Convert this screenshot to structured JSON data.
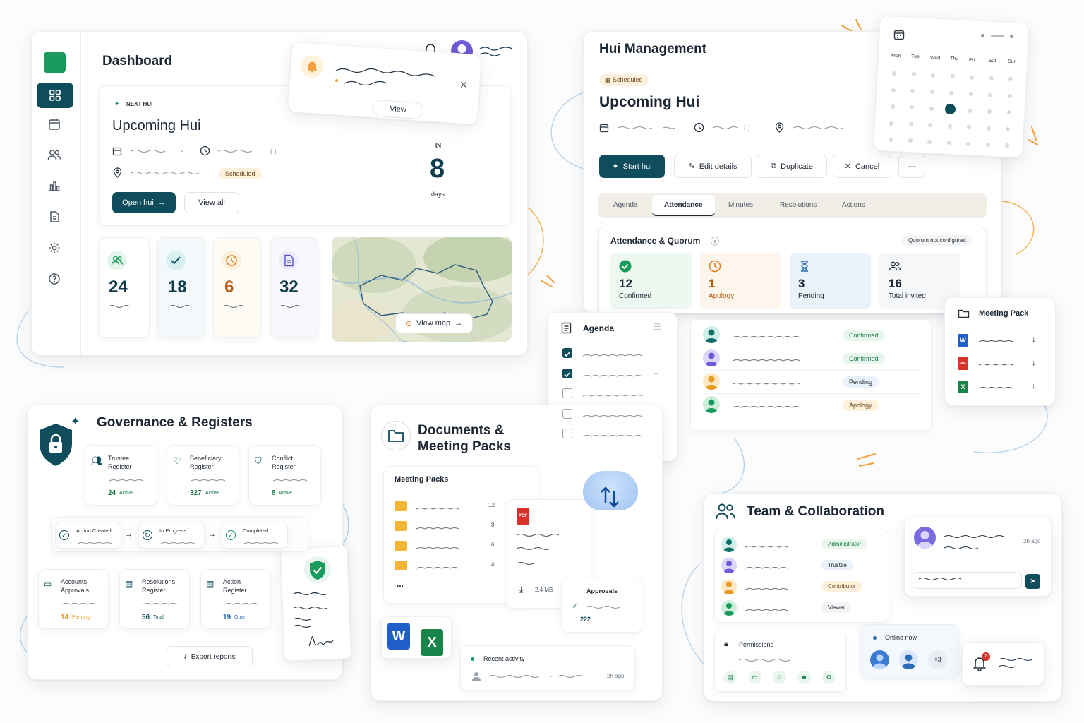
{
  "dashboard": {
    "title": "Dashboard",
    "next_hui_label": "NEXT HUI",
    "upcoming_title": "Upcoming Hui",
    "time_paren": "(   )",
    "status": "Scheduled",
    "open_btn": "Open hui",
    "view_all": "View all",
    "in_label": "IN",
    "days_count": "8",
    "days_label": "days",
    "stats": [
      "24",
      "18",
      "6",
      "32"
    ],
    "view_map": "View map",
    "notif_view": "View"
  },
  "hui": {
    "title": "Hui Management",
    "badge": "Scheduled",
    "upcoming": "Upcoming Hui",
    "time_paren": "(   )",
    "actions": {
      "start": "Start hui",
      "edit": "Edit details",
      "dup": "Duplicate",
      "cancel": "Cancel",
      "more": "···"
    },
    "tabs": [
      "Agenda",
      "Attendance",
      "Minutes",
      "Resolutions",
      "Actions"
    ],
    "attendance_title": "Attendance & Quorum",
    "quorum": "Quorum not configured",
    "stats": [
      {
        "n": "12",
        "label": "Confirmed"
      },
      {
        "n": "1",
        "label": "Apology"
      },
      {
        "n": "3",
        "label": "Pending"
      },
      {
        "n": "16",
        "label": "Total invited"
      }
    ],
    "attendee_status": [
      "Confirmed",
      "Confirmed",
      "Pending",
      "Apology"
    ]
  },
  "calendar": {
    "days": [
      "Mon",
      "Tue",
      "Wed",
      "Thu",
      "Fri",
      "Sat",
      "Sun"
    ]
  },
  "agenda": {
    "title": "Agenda"
  },
  "meeting_pack": {
    "title": "Meeting Pack",
    "files": [
      "W",
      "PDF",
      "X"
    ]
  },
  "governance": {
    "title": "Governance & Registers",
    "registers": [
      {
        "name": "Trustee\nRegister",
        "count": "24",
        "unit": "Active"
      },
      {
        "name": "Beneficiary\nRegister",
        "count": "327",
        "unit": "Active"
      },
      {
        "name": "Conflict\nRegister",
        "count": "8",
        "unit": "Active"
      }
    ],
    "flow": [
      "Action Created",
      "In Progress",
      "Completed"
    ],
    "bottom": [
      {
        "name": "Accounts\nApprovals",
        "count": "14",
        "unit": "Pending"
      },
      {
        "name": "Resolutions\nRegister",
        "count": "56",
        "unit": "Total"
      },
      {
        "name": "Action\nRegister",
        "count": "19",
        "unit": "Open"
      }
    ],
    "export": "Export reports"
  },
  "documents": {
    "title1": "Documents &",
    "title2": "Meeting Packs",
    "packs_title": "Meeting Packs",
    "pack_counts": [
      "12",
      "8",
      "6",
      "4"
    ],
    "more": "...",
    "pdf_label": "PDF",
    "file_size": "2.4 MB",
    "approvals": "Approvals",
    "approvals_count": "222",
    "recent": "Recent activity",
    "recent_time": "2h ago",
    "word": "W",
    "excel": "X"
  },
  "team": {
    "title": "Team & Collaboration",
    "roles": [
      "Administrator",
      "Trustee",
      "Contributor",
      "Viewer"
    ],
    "comment_time": "2h ago",
    "permissions": "Permissions",
    "online": "Online now",
    "online_more": "+3",
    "notif_count": "2"
  },
  "colors": {
    "primary": "#0f4c5c",
    "accent": "#0a8a5a",
    "orange": "#f2a03c"
  }
}
